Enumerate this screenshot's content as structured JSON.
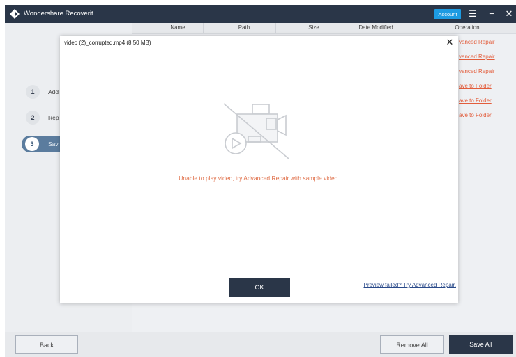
{
  "app": {
    "title": "Wondershare Recoverit",
    "account_label": "Account",
    "icons": {
      "logo": "recoverit-logo-icon",
      "menu": "hamburger-menu-icon",
      "minimize": "minimize-icon",
      "close": "close-icon"
    }
  },
  "sidebar": {
    "steps": [
      {
        "number": "1",
        "label": "Add"
      },
      {
        "number": "2",
        "label": "Rep"
      },
      {
        "number": "3",
        "label": "Sav"
      }
    ],
    "active_step": 3
  },
  "table": {
    "columns": [
      "Name",
      "Path",
      "Size",
      "Date Modified",
      "Operation"
    ],
    "operations": [
      "vanced Repair",
      "vanced Repair",
      "vanced Repair",
      "ave to Folder",
      "ave to Folder",
      "ave to Folder"
    ]
  },
  "modal": {
    "title": "video (2)_corrupted.mp4 (8.50 MB)",
    "close_icon": "close-icon",
    "preview_icon": "video-camera-slashed-icon",
    "message": "Unable to play video, try Advanced Repair with sample video.",
    "ok_label": "OK",
    "fail_link": "Preview failed? Try Advanced Repair."
  },
  "footer": {
    "back_label": "Back",
    "remove_all_label": "Remove All",
    "save_all_label": "Save All"
  },
  "colors": {
    "titlebar": "#2a3648",
    "account": "#1d9be2",
    "link_orange": "#e35d3c",
    "message_orange": "#e0704a",
    "link_blue": "#2a4a8a",
    "active_step": "#5b7c9e"
  }
}
